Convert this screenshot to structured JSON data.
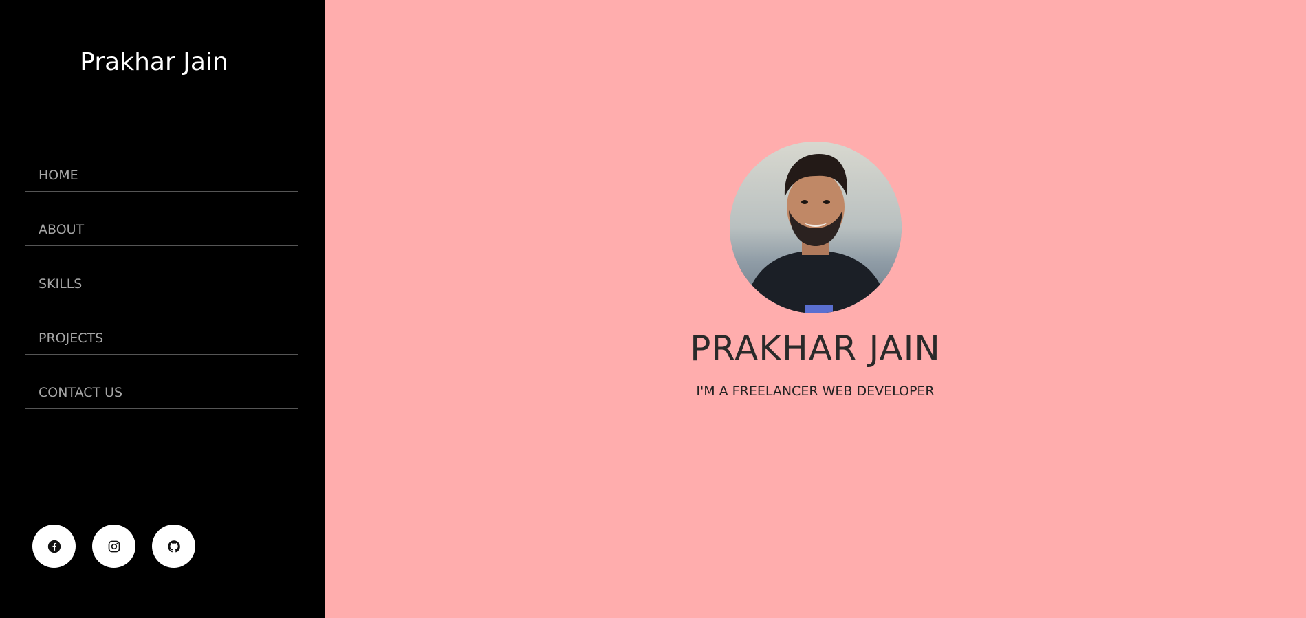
{
  "sidebar": {
    "brand": "Prakhar Jain",
    "nav": [
      {
        "label": "HOME"
      },
      {
        "label": "ABOUT"
      },
      {
        "label": "SKILLS"
      },
      {
        "label": "PROJECTS"
      },
      {
        "label": "CONTACT US"
      }
    ],
    "socials": [
      {
        "icon": "facebook-icon"
      },
      {
        "icon": "instagram-icon"
      },
      {
        "icon": "github-icon"
      }
    ]
  },
  "hero": {
    "name": "PRAKHAR JAIN",
    "tagline": "I'M A FREELANCER WEB DEVELOPER",
    "avatar": "profile-photo"
  },
  "colors": {
    "sidebar_bg": "#000000",
    "main_bg": "#ffadad",
    "nav_text": "#a6a6a6",
    "brand_text": "#ffffff",
    "heading_text": "#2a2a2a"
  }
}
